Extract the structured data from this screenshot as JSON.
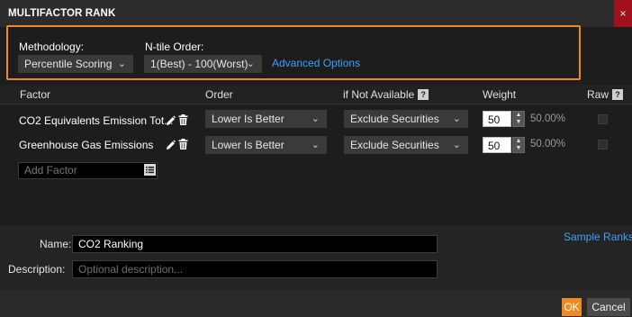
{
  "window": {
    "title": "MULTIFACTOR RANK",
    "close_glyph": "×"
  },
  "settings": {
    "methodology_label": "Methodology:",
    "methodology_value": "Percentile Scoring",
    "ntile_label": "N-tile Order:",
    "ntile_value": "1(Best) - 100(Worst)",
    "advanced_options": "Advanced Options"
  },
  "columns": {
    "factor": "Factor",
    "order": "Order",
    "if_not_available": "if Not Available",
    "weight": "Weight",
    "raw": "Raw",
    "help_glyph": "?"
  },
  "factors": [
    {
      "name": "CO2 Equivalents Emission Tot...",
      "order": "Lower Is Better",
      "if_not_available": "Exclude Securities",
      "weight": "50",
      "percent": "50.00%",
      "raw": false
    },
    {
      "name": "Greenhouse Gas Emissions",
      "order": "Lower Is Better",
      "if_not_available": "Exclude Securities",
      "weight": "50",
      "percent": "50.00%",
      "raw": false
    }
  ],
  "add_factor": {
    "placeholder": "Add Factor"
  },
  "form": {
    "name_label": "Name:",
    "name_value": "CO2 Ranking",
    "description_label": "Description:",
    "description_placeholder": "Optional description...",
    "sample_ranks": "Sample Ranks"
  },
  "footer": {
    "ok": "OK",
    "cancel": "Cancel"
  },
  "colors": {
    "accent_orange": "#f08a1e",
    "link_blue": "#3fa0ff",
    "close_red": "#a1111b"
  },
  "icons": [
    "pencil-icon",
    "trash-icon",
    "chevron-down-icon",
    "help-icon",
    "list-icon",
    "close-icon"
  ]
}
